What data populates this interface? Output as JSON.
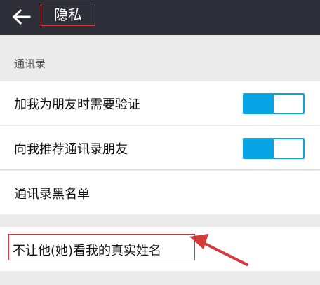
{
  "header": {
    "title": "隐私",
    "back_icon": "arrow-left-icon"
  },
  "sections": {
    "contacts_label": "通讯录"
  },
  "settings": {
    "verify_friend": {
      "label": "加我为朋友时需要验证",
      "enabled": true
    },
    "recommend_contacts": {
      "label": "向我推荐通讯录朋友",
      "enabled": true
    },
    "blacklist": {
      "label": "通讯录黑名单"
    },
    "hide_real_name": {
      "label": "不让他(她)看我的真实姓名"
    }
  },
  "colors": {
    "topbar": "#2f2f3a",
    "toggle_on": "#08a5e6",
    "annotation": "#d33a3a"
  }
}
